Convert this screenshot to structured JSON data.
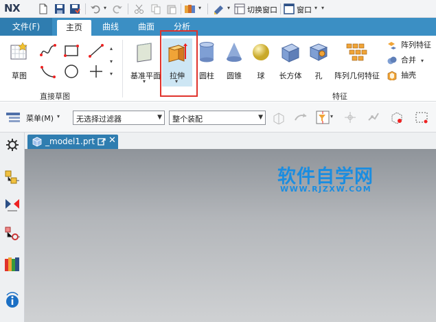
{
  "app": {
    "logo": "NX"
  },
  "quick_access": {
    "switch_window": "切换窗口",
    "window": "窗口",
    "icons": [
      "new-icon",
      "save-icon",
      "save-all-icon",
      "undo-icon",
      "redo-icon",
      "cut-icon",
      "copy-icon",
      "paste-icon",
      "touch-mode-icon",
      "repeat-command-icon",
      "switch-window-icon",
      "window-icon"
    ]
  },
  "tabs": [
    {
      "label": "文件(F)",
      "active": false
    },
    {
      "label": "主页",
      "active": true
    },
    {
      "label": "曲线",
      "active": false
    },
    {
      "label": "曲面",
      "active": false
    },
    {
      "label": "分析",
      "active": false
    }
  ],
  "ribbon": {
    "sketch_group": {
      "sketch": "草图",
      "label": "直接草图"
    },
    "feature_group": {
      "datum_plane": "基准平面",
      "extrude": "拉伸",
      "cylinder": "圆柱",
      "cone": "圆锥",
      "sphere": "球",
      "block": "长方体",
      "hole": "孔",
      "pattern_geometry": "阵列几何特征",
      "label": "特征"
    },
    "right_items": {
      "pattern_feature": "阵列特征",
      "unite": "合并",
      "shell": "抽壳"
    }
  },
  "toolbar": {
    "menu": "菜单(M)",
    "filter": "无选择过滤器",
    "scope": "整个装配"
  },
  "document": {
    "tab": "_model1.prt"
  },
  "watermark": {
    "main": "软件自学网",
    "sub": "WWW.RJZXW.COM"
  },
  "colors": {
    "tab_bar": "#3b8fc4",
    "highlight": "#cde6f4",
    "callout": "#e0322b",
    "watermark": "#1b8de0"
  }
}
